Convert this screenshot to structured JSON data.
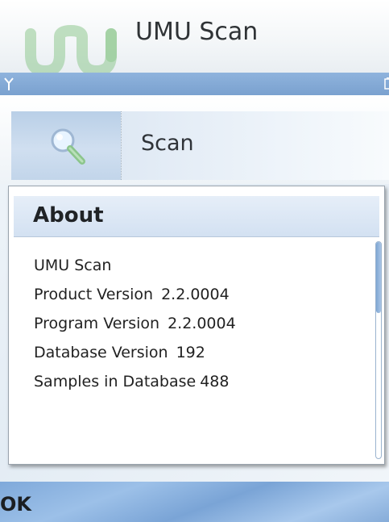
{
  "app": {
    "title": "UMU Scan",
    "logo_icon": "umu-logo",
    "logo_color": "#4a9a4a"
  },
  "statusbar": {
    "left_icon": "signal-antenna-icon",
    "right_icon": "battery-icon",
    "color": "#7aa1cf"
  },
  "tabs": [
    {
      "icon": "magnifier-icon",
      "label": "Scan"
    }
  ],
  "dialog": {
    "title": "About",
    "lines": [
      {
        "label": "UMU Scan",
        "value": ""
      },
      {
        "label": "Product Version",
        "value": "2.2.0004"
      },
      {
        "label": "Program Version",
        "value": "2.2.0004"
      },
      {
        "label": "Database Version",
        "value": "192"
      },
      {
        "label": "Samples in Database",
        "value": "488"
      }
    ]
  },
  "softkeys": {
    "left_label": "OK"
  }
}
